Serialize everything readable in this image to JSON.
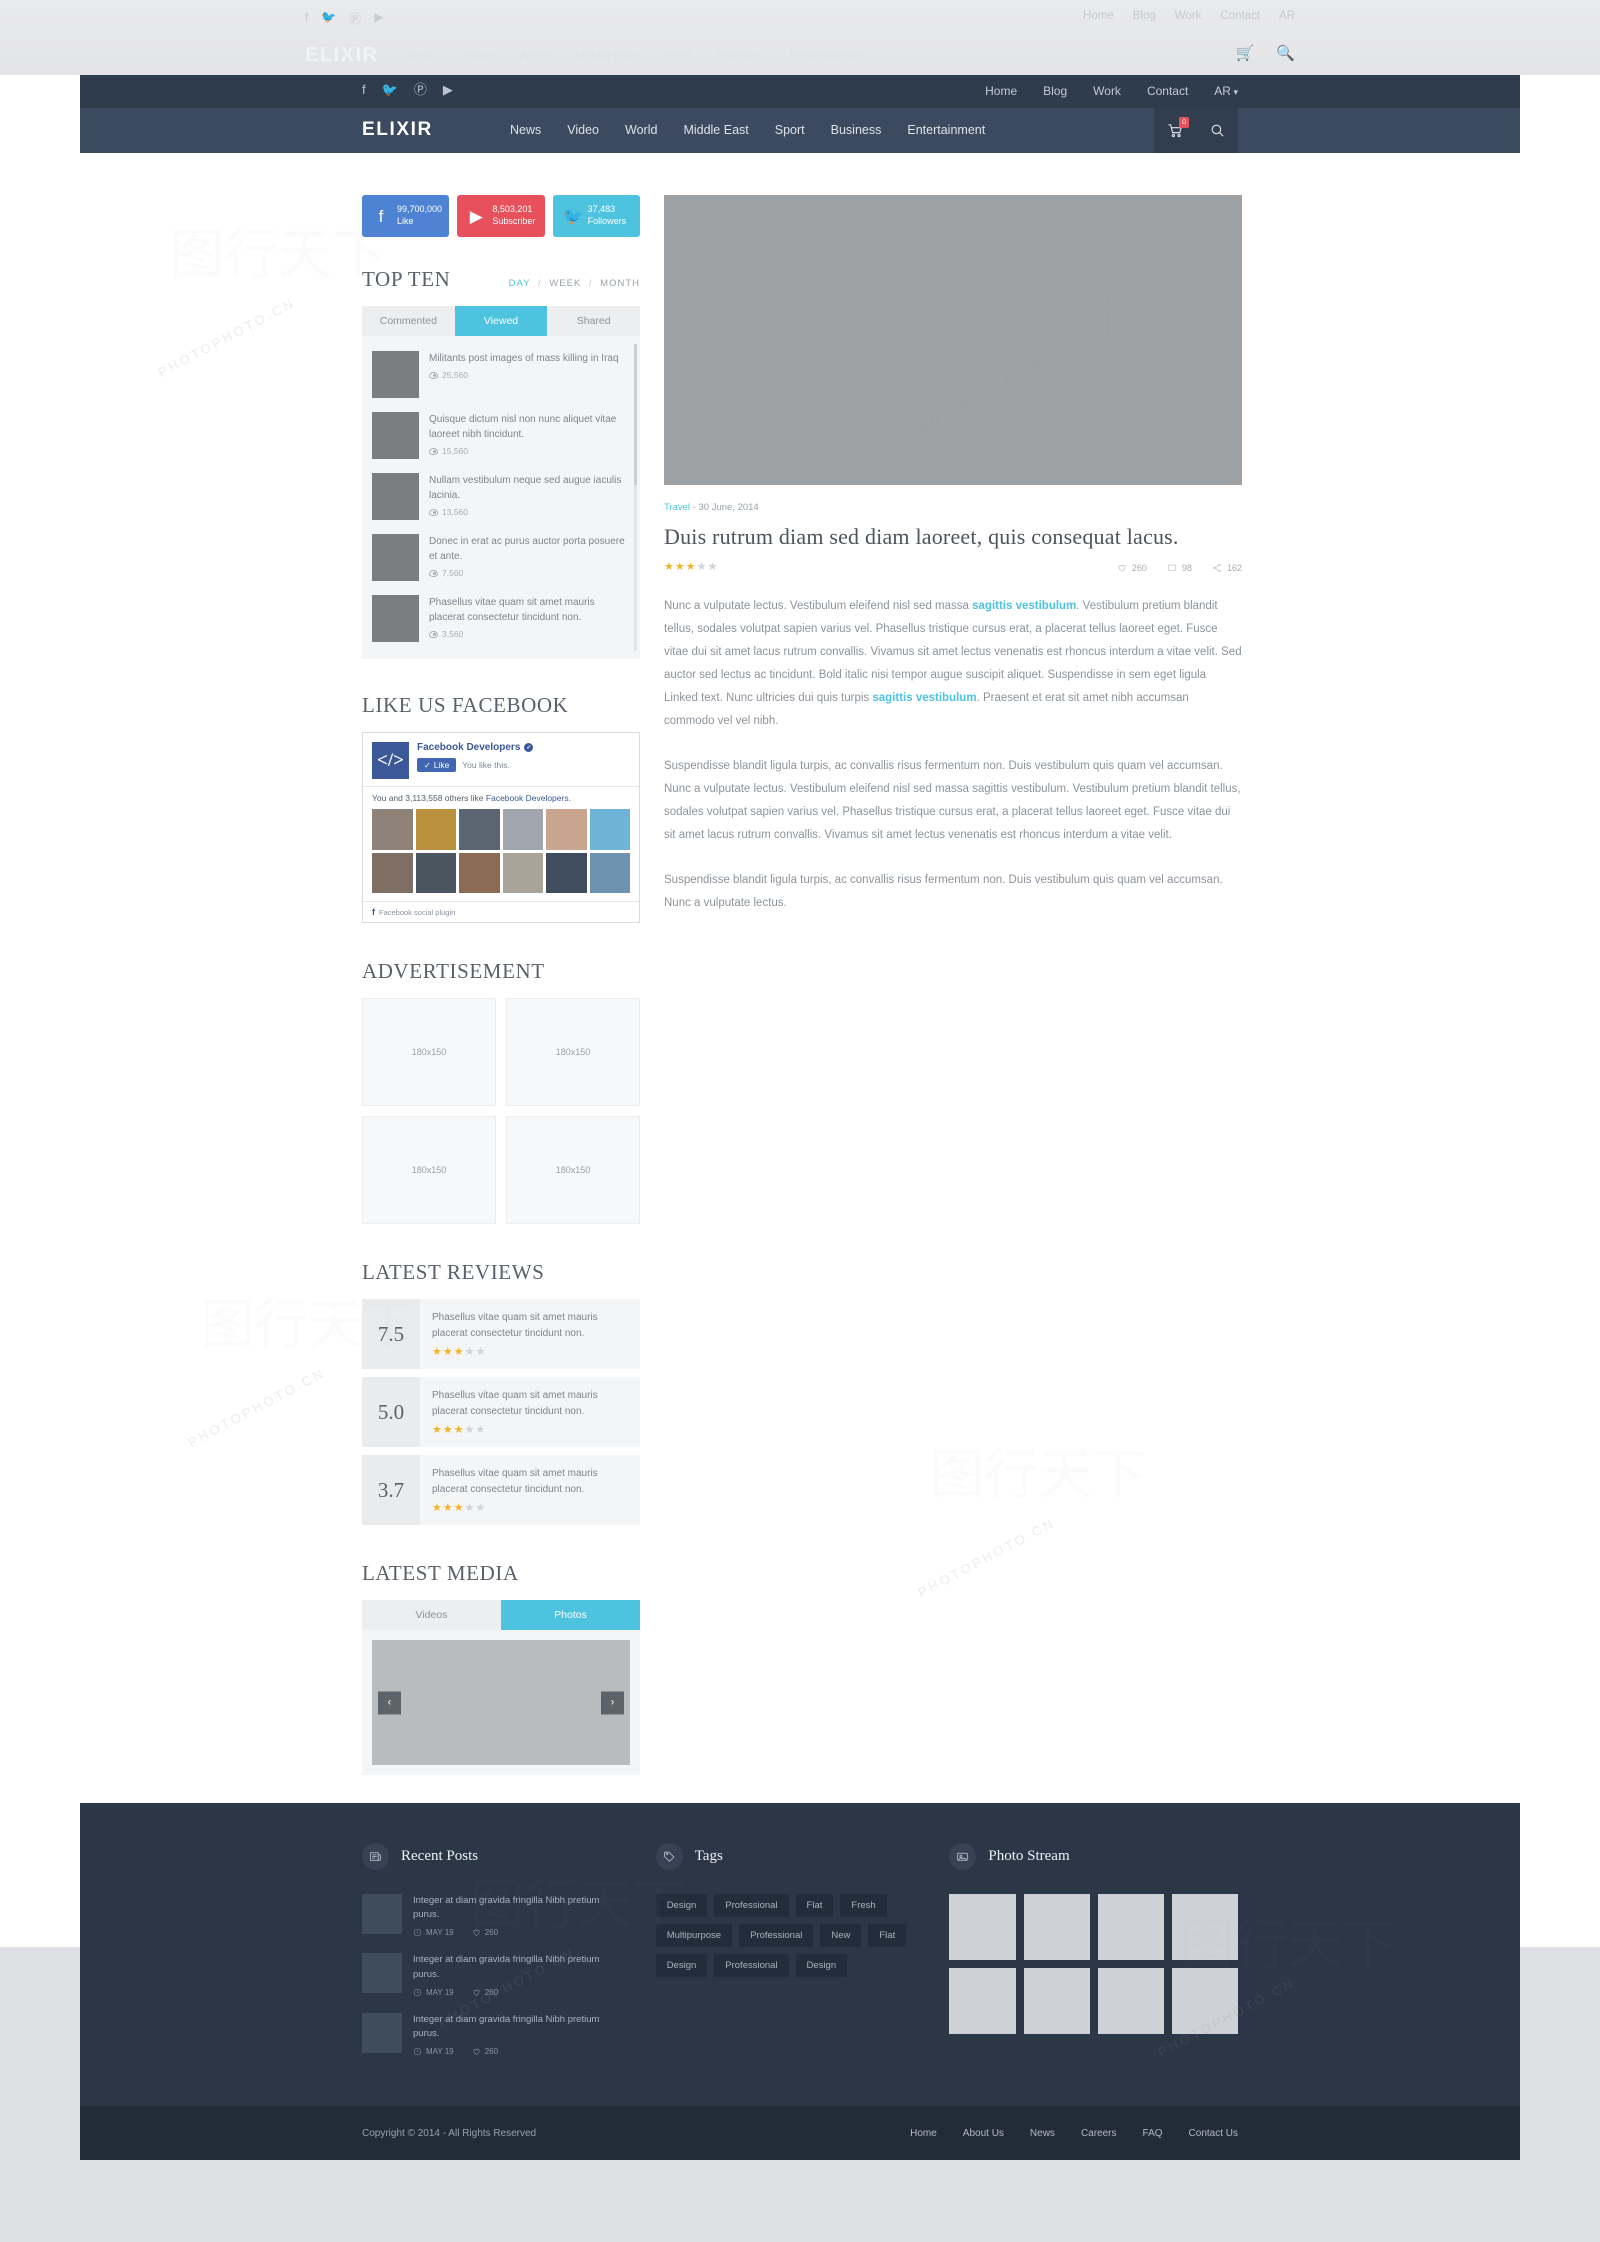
{
  "topbar": {
    "social_icons": [
      "facebook-icon",
      "twitter-icon",
      "pinterest-icon",
      "youtube-icon"
    ],
    "social_glyphs": [
      "f",
      "🐦",
      "Ⓟ",
      "▶"
    ],
    "nav": [
      "Home",
      "Blog",
      "Work",
      "Contact"
    ],
    "lang": "AR"
  },
  "navbar": {
    "brand": "ELIXIR",
    "menu": [
      "News",
      "Video",
      "World",
      "Middle East",
      "Sport",
      "Business",
      "Entertainment"
    ],
    "cart_count": "0",
    "cart_icon": "cart-icon",
    "search_icon": "search-icon"
  },
  "social_counts": [
    {
      "network": "facebook",
      "glyph": "f",
      "value": "99,700,000",
      "label": "Like",
      "color": "#4e83d4"
    },
    {
      "network": "youtube",
      "glyph": "▶",
      "value": "8,503,201",
      "label": "Subscriber",
      "color": "#e8505b"
    },
    {
      "network": "twitter",
      "glyph": "🐦",
      "value": "37,483",
      "label": "Followers",
      "color": "#4ec3e0"
    }
  ],
  "top_ten": {
    "title": "TOP TEN",
    "periods": [
      "DAY",
      "WEEK",
      "MONTH"
    ],
    "active_period": "DAY",
    "tabs": [
      "Commented",
      "Viewed",
      "Shared"
    ],
    "active_tab": "Viewed",
    "items": [
      {
        "title": "Militants post images of mass killing in Iraq",
        "views": "25,560"
      },
      {
        "title": "Quisque dictum nisl non nunc aliquet vitae laoreet nibh tincidunt.",
        "views": "15,560"
      },
      {
        "title": "Nullam vestibulum neque sed augue iaculis lacinia.",
        "views": "13,560"
      },
      {
        "title": "Donec in erat ac purus auctor porta posuere et ante.",
        "views": "7,560"
      },
      {
        "title": "Phasellus vitae quam sit amet mauris placerat consectetur tincidunt non.",
        "views": "3,560"
      }
    ]
  },
  "facebook_widget": {
    "title": "LIKE US FACEBOOK",
    "page_name": "Facebook Developers",
    "like_button": "Like",
    "like_state": "You like this.",
    "others_prefix": "You and 3,113,558 others like ",
    "others_link": "Facebook Developers",
    "others_suffix": ".",
    "footer": "Facebook social plugin"
  },
  "advertisement": {
    "title": "ADVERTISEMENT",
    "boxes": [
      "180x150",
      "180x150",
      "180x150",
      "180x150"
    ]
  },
  "latest_reviews": {
    "title": "LATEST REVIEWS",
    "items": [
      {
        "score": "7.5",
        "text": "Phasellus vitae quam sit amet mauris placerat consectetur tincidunt non.",
        "stars": 3,
        "max_stars": 5
      },
      {
        "score": "5.0",
        "text": "Phasellus vitae quam sit amet mauris placerat consectetur tincidunt non.",
        "stars": 3,
        "max_stars": 5
      },
      {
        "score": "3.7",
        "text": "Phasellus vitae quam sit amet mauris placerat consectetur tincidunt non.",
        "stars": 3,
        "max_stars": 5
      }
    ]
  },
  "latest_media": {
    "title": "LATEST MEDIA",
    "tabs": [
      "Videos",
      "Photos"
    ],
    "active_tab": "Photos",
    "prev_arrow": "‹",
    "next_arrow": "›"
  },
  "article": {
    "category": "Travel",
    "separator": " - ",
    "date": "30 June, 2014",
    "title": "Duis rutrum diam sed diam laoreet, quis consequat lacus.",
    "stars": 3,
    "max_stars": 5,
    "likes": "260",
    "comments": "98",
    "shares": "162",
    "paragraphs": [
      {
        "runs": [
          {
            "t": "Nunc a vulputate lectus. Vestibulum eleifend nisl sed massa ",
            "link": false
          },
          {
            "t": "sagittis vestibulum",
            "link": true
          },
          {
            "t": ". Vestibulum pretium blandit tellus, sodales volutpat sapien varius vel. Phasellus tristique cursus erat, a placerat tellus laoreet eget. Fusce vitae dui sit amet lacus rutrum convallis. Vivamus sit amet lectus venenatis est rhoncus interdum a vitae velit. Sed auctor sed lectus ac tincidunt. Bold italic nisi tempor augue suscipit aliquet. Suspendisse in sem eget ligula Linked text. Nunc ultricies dui quis turpis ",
            "link": false
          },
          {
            "t": "sagittis vestibulum",
            "link": true
          },
          {
            "t": ". Praesent et erat sit amet nibh accumsan commodo vel vel nibh.",
            "link": false
          }
        ]
      },
      {
        "runs": [
          {
            "t": "Suspendisse blandit ligula turpis, ac convallis risus fermentum non. Duis vestibulum quis quam vel accumsan. Nunc a vulputate lectus. Vestibulum eleifend nisl sed massa sagittis vestibulum. Vestibulum pretium blandit tellus, sodales volutpat sapien varius vel. Phasellus tristique cursus erat, a placerat tellus laoreet eget. Fusce vitae dui sit amet lacus rutrum convallis. Vivamus sit amet lectus venenatis est rhoncus interdum a vitae velit.",
            "link": false
          }
        ]
      },
      {
        "runs": [
          {
            "t": "Suspendisse blandit ligula turpis, ac convallis risus fermentum non. Duis vestibulum quis quam vel accumsan. Nunc a vulputate lectus.",
            "link": false
          }
        ]
      }
    ]
  },
  "footer": {
    "recent_posts": {
      "title": "Recent Posts",
      "icon": "newspaper-icon",
      "items": [
        {
          "title": "Integer at diam gravida fringilla Nibh pretium purus.",
          "date": "MAY 19",
          "likes": "260"
        },
        {
          "title": "Integer at diam gravida fringilla Nibh pretium purus.",
          "date": "MAY 19",
          "likes": "260"
        },
        {
          "title": "Integer at diam gravida fringilla Nibh pretium purus.",
          "date": "MAY 19",
          "likes": "260"
        }
      ]
    },
    "tags": {
      "title": "Tags",
      "icon": "tag-icon",
      "items": [
        "Design",
        "Professional",
        "Flat",
        "Fresh",
        "Multipurpose",
        "Professional",
        "New",
        "Flat",
        "Design",
        "Professional",
        "Design"
      ]
    },
    "photo_stream": {
      "title": "Photo Stream",
      "icon": "photo-icon",
      "count": 8
    },
    "copyright": "Copyright © 2014 - All Rights Reserved",
    "links": [
      "Home",
      "About Us",
      "News",
      "Careers",
      "FAQ",
      "Contact Us"
    ]
  },
  "watermark": {
    "text": "PHOTOPHOTO.CN",
    "brand": "图行天下"
  },
  "colors": {
    "accent": "#4ec3e0",
    "nav_dark": "#3b4a5e",
    "topbar_dark": "#2f3c4e",
    "footer_dark": "#2b3647",
    "copybar_dark": "#222b38",
    "star_on": "#f0b429"
  }
}
